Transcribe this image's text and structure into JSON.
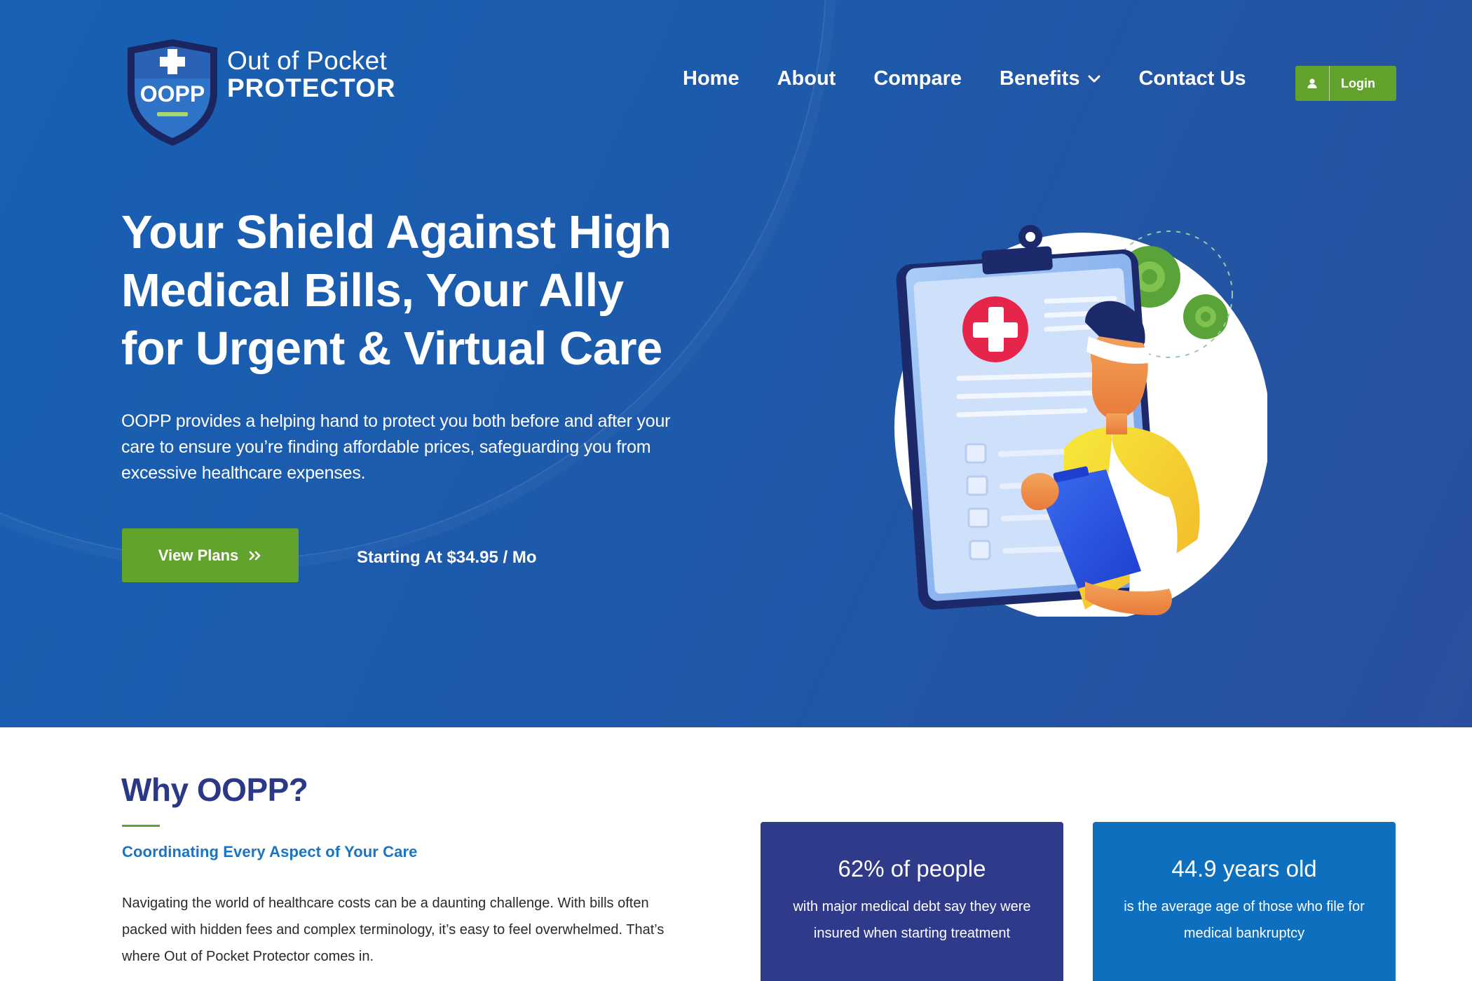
{
  "brand": {
    "shield_text": "OOPP",
    "name_line1": "Out of Pocket",
    "name_line2": "PROTECTOR"
  },
  "nav": {
    "items": [
      {
        "label": "Home"
      },
      {
        "label": "About"
      },
      {
        "label": "Compare"
      },
      {
        "label": "Benefits",
        "has_dropdown": true
      },
      {
        "label": "Contact Us"
      }
    ],
    "login_label": "Login"
  },
  "hero": {
    "headline": "Your Shield Against High Medical Bills, Your Ally for Urgent & Virtual Care",
    "lead": "OOPP provides a helping hand to protect you both before and after your care to ensure you’re finding affordable prices, safeguarding you from excessive healthcare expenses.",
    "cta_label": "View Plans",
    "price_note": "Starting At $34.95 / Mo"
  },
  "why": {
    "title": "Why OOPP?",
    "subtitle": "Coordinating Every Aspect of Your Care",
    "body": "Navigating the world of healthcare costs can be a daunting challenge. With bills often packed with hidden fees and complex terminology, it’s easy to feel overwhelmed. That’s where Out of Pocket Protector comes in.",
    "stats": [
      {
        "big": "62% of people",
        "small": "with major medical debt say they were insured when starting treatment"
      },
      {
        "big": "44.9 years old",
        "small": "is the average age of those who file for medical bankruptcy"
      }
    ]
  },
  "colors": {
    "hero_blue": "#1d5aab",
    "accent_green": "#62a32e",
    "navy": "#2b3888",
    "link_blue": "#1b74c2",
    "stat_blue": "#0d6fbd"
  }
}
